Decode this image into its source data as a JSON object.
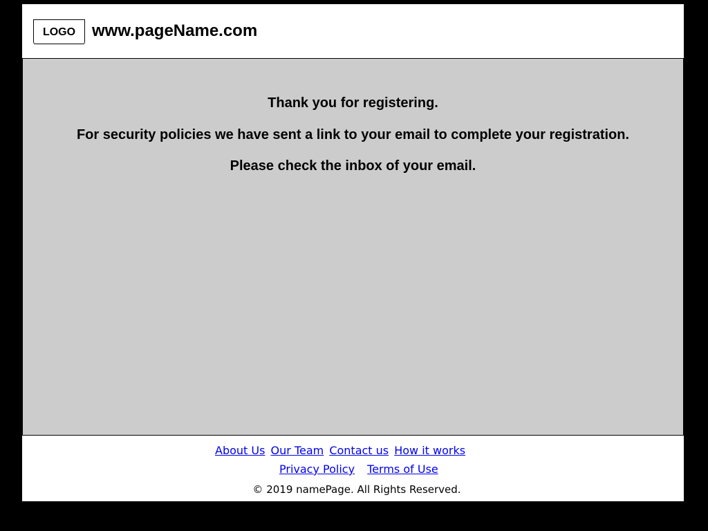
{
  "header": {
    "logo_label": "LOGO",
    "site_name": "www.pageName.com"
  },
  "main": {
    "messages": [
      "Thank you for registering.",
      "For security policies we have sent a link to your email to complete your registration.",
      "Please check the inbox of your email."
    ]
  },
  "footer": {
    "links_row1": [
      "About Us",
      "Our Team",
      "Contact us",
      "How it works"
    ],
    "links_row2": [
      "Privacy Policy",
      "Terms of Use"
    ],
    "copyright": "© 2019 namePage. All Rights Reserved."
  },
  "colors": {
    "page_background": "#000000",
    "content_background": "#cccccc",
    "link": "#0000ee"
  }
}
